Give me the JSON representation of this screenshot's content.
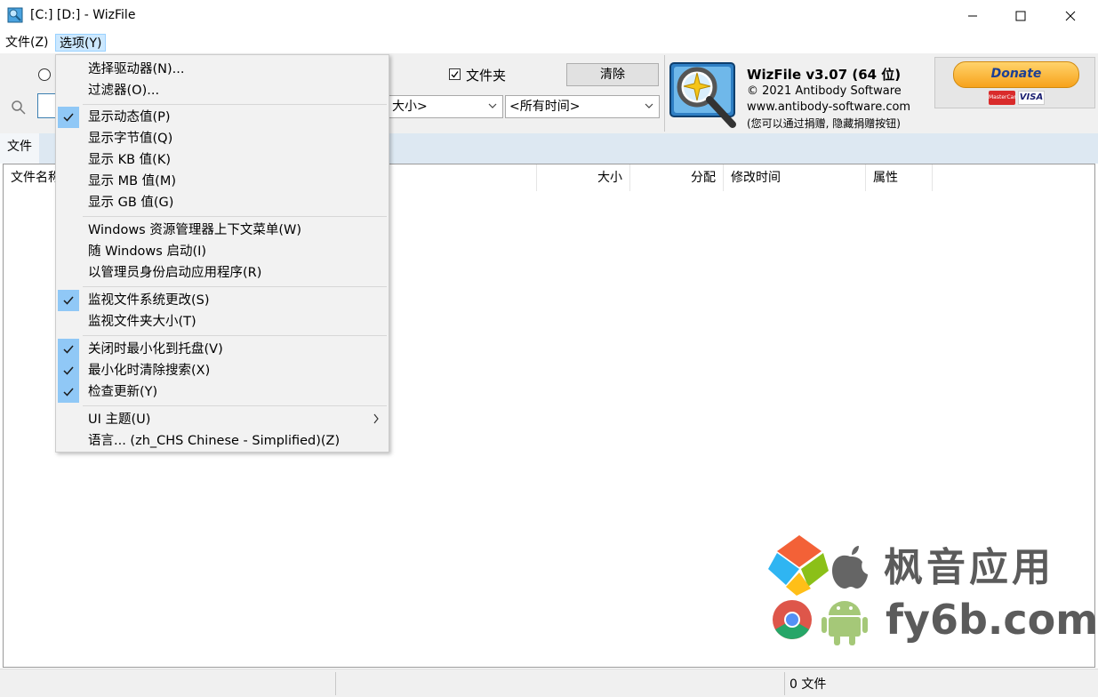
{
  "window": {
    "title": "[C:] [D:]  - WizFile"
  },
  "menubar": {
    "file": "文件(Z)",
    "options": "选项(Y)"
  },
  "toolbar": {
    "folder_checkbox_label": "文件夹",
    "clear_button": "清除",
    "size_combo": "大小>",
    "time_combo": "<所有时间>"
  },
  "about": {
    "product": "WizFile v3.07 (64 位)",
    "copyright": "© 2021 Antibody Software",
    "url": "www.antibody-software.com",
    "note": "(您可以通过捐赠, 隐藏捐赠按钮)",
    "donate": "Donate",
    "card1": "MasterCard",
    "card2": "VISA",
    "colors": {
      "donate_bg": "#f7a21b",
      "donate_text": "#1c3f94"
    }
  },
  "tabs": {
    "files": "文件"
  },
  "columns": {
    "name": "文件名称",
    "size": "大小",
    "alloc": "分配",
    "modified": "修改时间",
    "attrs": "属性"
  },
  "status": {
    "file_count": "0 文件"
  },
  "dropdown": {
    "items": [
      {
        "label": "选择驱动器(N)...",
        "checked": false
      },
      {
        "label": "过滤器(O)...",
        "checked": false
      },
      {
        "label": "显示动态值(P)",
        "checked": true
      },
      {
        "label": "显示字节值(Q)",
        "checked": false
      },
      {
        "label": "显示 KB 值(K)",
        "checked": false
      },
      {
        "label": "显示 MB 值(M)",
        "checked": false
      },
      {
        "label": "显示 GB 值(G)",
        "checked": false
      },
      {
        "label": "Windows 资源管理器上下文菜单(W)",
        "checked": false
      },
      {
        "label": "随 Windows 启动(I)",
        "checked": false
      },
      {
        "label": "以管理员身份启动应用程序(R)",
        "checked": false
      },
      {
        "label": "监视文件系统更改(S)",
        "checked": true
      },
      {
        "label": "监视文件夹大小(T)",
        "checked": false
      },
      {
        "label": "关闭时最小化到托盘(V)",
        "checked": true
      },
      {
        "label": "最小化时清除搜索(X)",
        "checked": true
      },
      {
        "label": "检查更新(Y)",
        "checked": true
      },
      {
        "label": "UI 主题(U)",
        "checked": false
      },
      {
        "label": "语言... (zh_CHS Chinese - Simplified)(Z)",
        "checked": false
      }
    ]
  },
  "watermark": {
    "brand": "枫音应用",
    "domain": "fy6b.com"
  }
}
